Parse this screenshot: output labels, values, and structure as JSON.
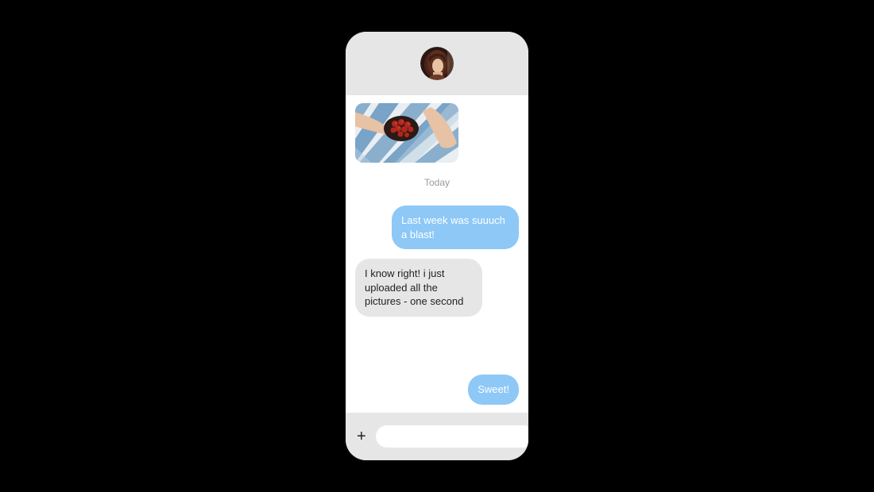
{
  "header": {
    "avatar_icon": "contact-avatar"
  },
  "chat": {
    "date_label": "Today",
    "messages": [
      {
        "type": "image",
        "from": "them",
        "alt": "photo-attachment"
      },
      {
        "type": "text",
        "from": "me",
        "text": "Last week was suuuch a blast!"
      },
      {
        "type": "text",
        "from": "them",
        "text": "I know right! i just uploaded all the pictures - one second"
      },
      {
        "type": "text",
        "from": "me",
        "text": "Sweet!"
      }
    ]
  },
  "composer": {
    "add_icon": "plus-icon",
    "input_placeholder": "",
    "input_value": "",
    "send_icon": "send-icon"
  },
  "colors": {
    "sent_bubble": "#8dc8f7",
    "received_bubble": "#e6e6e6",
    "phone_bg": "#e6e6e6",
    "chat_bg": "#ffffff"
  }
}
